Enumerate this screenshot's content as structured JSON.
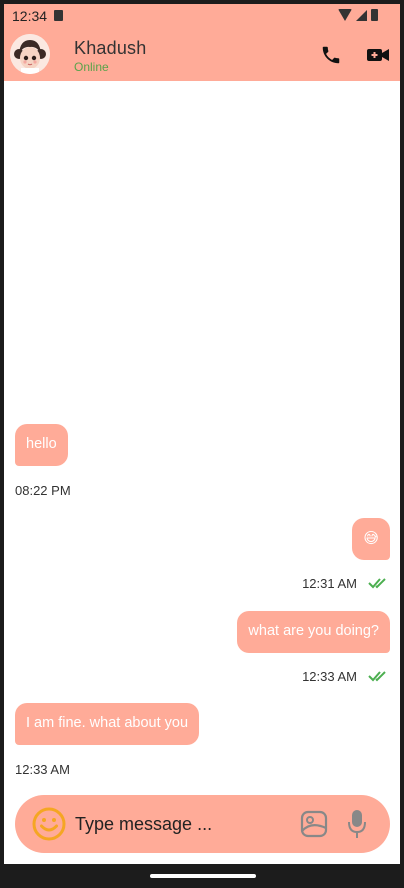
{
  "status_bar": {
    "time": "12:34"
  },
  "header": {
    "contact_name": "Khadush",
    "status": "Online",
    "icons": [
      "avatar",
      "phone-icon",
      "video-call-icon"
    ]
  },
  "messages": [
    {
      "direction": "received",
      "text": "hello",
      "time": "08:22 PM"
    },
    {
      "direction": "sent",
      "text": "😅",
      "time": "12:31 AM",
      "read": true
    },
    {
      "direction": "sent",
      "text": "what are you doing?",
      "time": "12:33 AM",
      "read": true
    },
    {
      "direction": "received",
      "text": "I am fine. what about you",
      "time": "12:33 AM"
    }
  ],
  "composer": {
    "placeholder": "Type message ...",
    "icons": [
      "emoji-icon",
      "gallery-icon",
      "mic-icon"
    ]
  },
  "colors": {
    "accent": "#ffab98",
    "online": "#5aa34a",
    "read_ticks": "#4caf50",
    "emoji_icon": "#f5a623"
  }
}
